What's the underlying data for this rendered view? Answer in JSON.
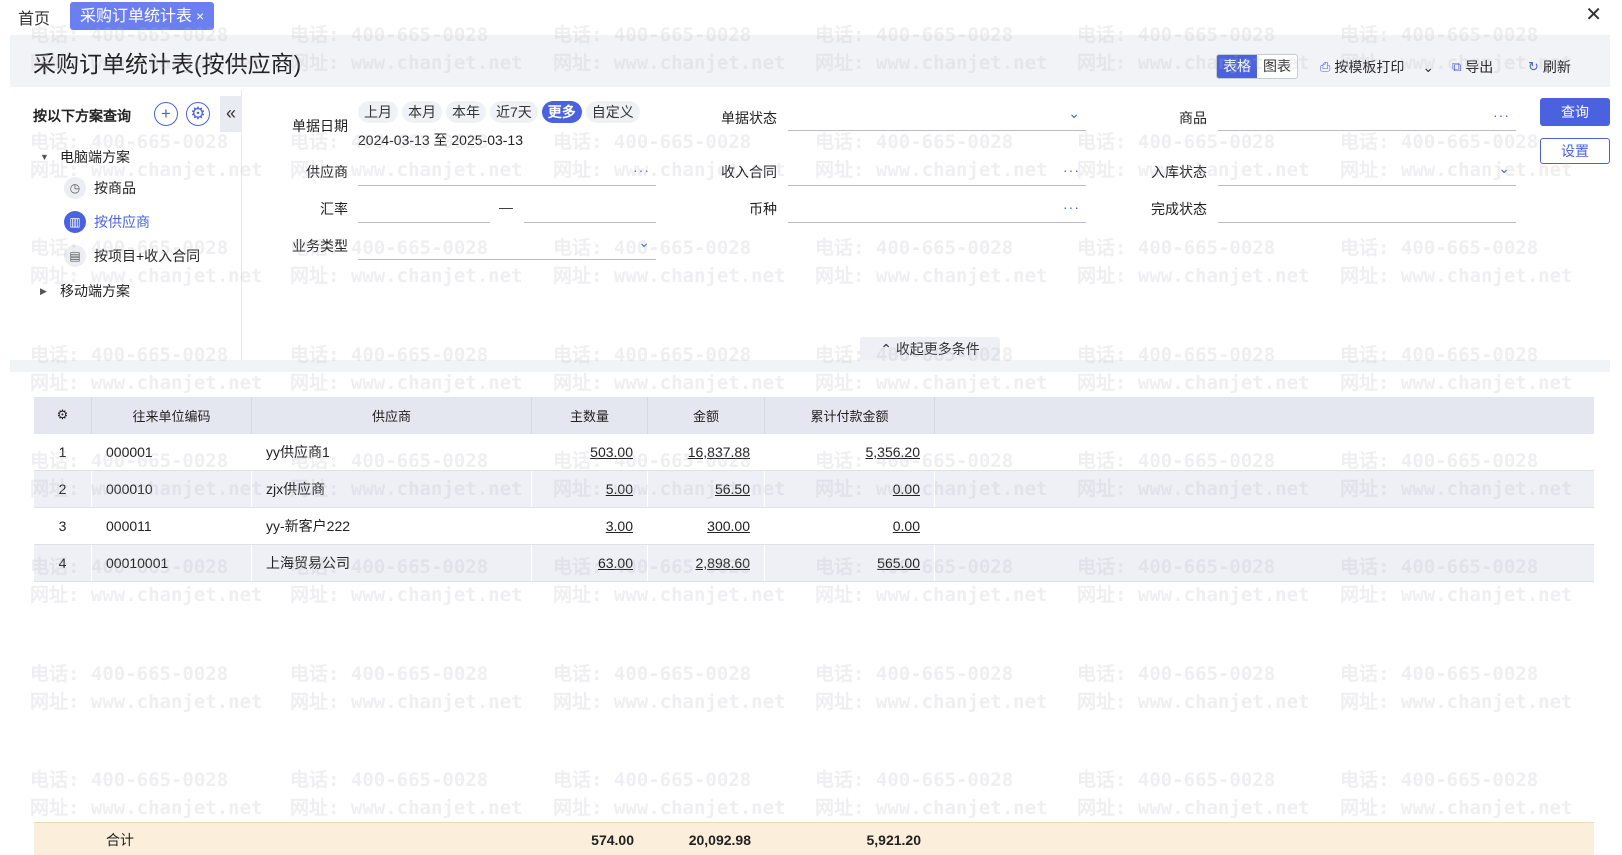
{
  "tabs": {
    "home": "首页",
    "active": "采购订单统计表",
    "close_tab": "×",
    "close_window": "✕"
  },
  "header": {
    "title": "采购订单统计表(按供应商)",
    "view_table": "表格",
    "view_chart": "图表",
    "print": "按模板打印",
    "export": "导出",
    "refresh": "刷新"
  },
  "left_panel": {
    "title": "按以下方案查询",
    "collapse": "«",
    "groups": [
      {
        "label": "电脑端方案",
        "expanded": true,
        "items": [
          {
            "label": "按商品",
            "icon": "clock-icon"
          },
          {
            "label": "按供应商",
            "icon": "chart-icon",
            "active": true
          },
          {
            "label": "按项目+收入合同",
            "icon": "contract-icon"
          }
        ]
      },
      {
        "label": "移动端方案",
        "expanded": false
      }
    ]
  },
  "filters": {
    "date_label": "单据日期",
    "date_chips": [
      "上月",
      "本月",
      "本年",
      "近7天",
      "更多",
      "自定义"
    ],
    "date_active": "更多",
    "date_range": "2024-03-13 至 2025-03-13",
    "supplier": "供应商",
    "exchange_rate": "汇率",
    "rate_sep": "—",
    "biz_type": "业务类型",
    "doc_status": "单据状态",
    "income_contract": "收入合同",
    "currency": "币种",
    "product": "商品",
    "inbound_status": "入库状态",
    "complete_status": "完成状态",
    "query_btn": "查询",
    "settings_btn": "设置",
    "collapse_more": "收起更多条件"
  },
  "table": {
    "columns": [
      "往来单位编码",
      "供应商",
      "主数量",
      "金额",
      "累计付款金额"
    ],
    "rows": [
      {
        "no": "1",
        "code": "000001",
        "supplier": "yy供应商1",
        "qty": "503.00",
        "amount": "16,837.88",
        "paid": "5,356.20"
      },
      {
        "no": "2",
        "code": "000010",
        "supplier": "zjx供应商",
        "qty": "5.00",
        "amount": "56.50",
        "paid": "0.00"
      },
      {
        "no": "3",
        "code": "000011",
        "supplier": "yy-新客户222",
        "qty": "3.00",
        "amount": "300.00",
        "paid": "0.00"
      },
      {
        "no": "4",
        "code": "00010001",
        "supplier": "上海贸易公司",
        "qty": "63.00",
        "amount": "2,898.60",
        "paid": "565.00"
      }
    ],
    "total": {
      "label": "合计",
      "qty": "574.00",
      "amount": "20,092.98",
      "paid": "5,921.20"
    }
  },
  "watermark": {
    "phone": "电话: 400-665-0028",
    "site": "网址: www.chanjet.net"
  },
  "colors": {
    "accent": "#4a62e0",
    "tab_active": "#6b7ff0",
    "total_row": "#fbeedb"
  }
}
